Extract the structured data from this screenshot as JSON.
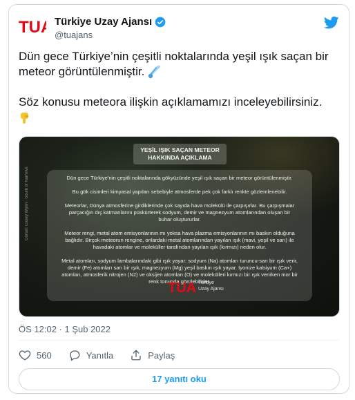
{
  "author": {
    "name": "Türkiye Uzay Ajansı",
    "handle": "@tuajans",
    "logo_text": "TUA"
  },
  "tweet": {
    "line1": "Dün gece Türkiye’nin çeşitli noktalarında yeşil ışık saçan bir",
    "line2": "meteor görüntülenmiştir.",
    "line3": "Söz konusu meteora ilişkin açıklamamızı inceleyebilirsiniz.",
    "emoji_meteor": "☄",
    "emoji_point": "👇"
  },
  "media": {
    "side_credit": "Görsel: Casey Wynn · South of Narrows",
    "title_line1": "YEŞİL IŞIK SAÇAN METEOR",
    "title_line2": "HAKKINDA AÇIKLAMA",
    "p1": "Dün gece Türkiye’nin çeşitli noktalarında gökyüzünde yeşil ışık saçan bir meteor görüntülenmiştir.",
    "p2": "Bu gök cisimleri kimyasal yapıları sebebiyle atmosferde pek çok farklı renkte gözlemlenebilir.",
    "p3a": "Meteorlar, Dünya atmosferine girdiklerinde çok sayıda hava molekülü ile çarpışırlar. Bu çarpışmalar",
    "p3b": "parçacığın dış katmanlarını püskürterek sodyum, demir ve magnezyum atomlarından oluşan bir",
    "p3c": "buhar oluştururlar.",
    "p4a": "Meteor rengi, metal atom emisyonlarının mı yoksa hava plazma emisyonlarının mı baskın olduğuna",
    "p4b": "bağlıdır. Birçok meteorun rengine, onlardaki metal atomlarından yayılan ışık (mavi, yeşil ve sarı) ile",
    "p4c": "havadaki atomlar ve moleküller tarafından yayılan ışık (kırmızı) neden olur.",
    "p5a": "Metal atomları, sodyum lambalarındaki gibi ışık yayar: sodyum (Na) atomları turuncu-sarı bir ışık verir,",
    "p5b": "demir (Fe) atomları sarı bir ışık, magnezyum (Mg) yeşil baskın ışık yayar. İyonize kalsiyum (Ca+)",
    "p5c": "atomları, atmosferik nitrojen (N2) ve oksijen atomları (O) ve molekülleri kırmızı bir ışık verirken mor bir",
    "p5d": "renk tonunda görülebilirler.",
    "logo_line1": "Türkiye",
    "logo_line2": "Uzay Ajansı"
  },
  "meta": {
    "timestamp": "ÖS 12:02 · 1 Şub 2022"
  },
  "actions": {
    "likes": "560",
    "reply_label": "Yanıtla",
    "share_label": "Paylaş"
  },
  "replies_button": "17 yanıtı oku",
  "colors": {
    "brand_red": "#e30a17",
    "twitter_blue": "#1d9bf0",
    "muted": "#536471"
  },
  "icons": [
    "tua-logo-icon",
    "verified-badge-icon",
    "twitter-bird-icon",
    "heart-icon",
    "reply-icon",
    "share-icon"
  ]
}
